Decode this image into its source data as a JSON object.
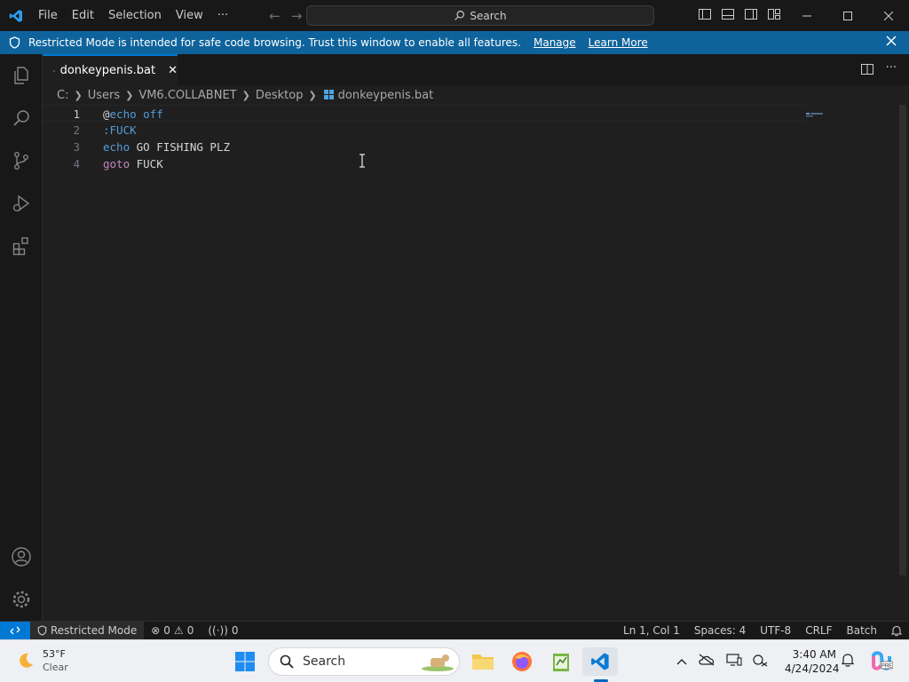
{
  "menu": [
    "File",
    "Edit",
    "Selection",
    "View",
    "···"
  ],
  "command_center": {
    "label": "Search"
  },
  "banner": {
    "message": "Restricted Mode is intended for safe code browsing. Trust this window to enable all features.",
    "manage": "Manage",
    "learn_more": "Learn More"
  },
  "tab": {
    "title": "donkeypenis.bat"
  },
  "breadcrumb": [
    "C:",
    "Users",
    "VM6.COLLABNET",
    "Desktop",
    "donkeypenis.bat"
  ],
  "editor": {
    "lines": [
      {
        "n": "1",
        "parts": [
          {
            "t": "@",
            "c": "txt"
          },
          {
            "t": "echo off",
            "c": "kw-blue"
          }
        ]
      },
      {
        "n": "2",
        "parts": [
          {
            "t": ":FUCK",
            "c": "kw-blue"
          }
        ]
      },
      {
        "n": "3",
        "parts": [
          {
            "t": "echo",
            "c": "kw-blue"
          },
          {
            "t": " GO FISHING PLZ",
            "c": "txt"
          }
        ]
      },
      {
        "n": "4",
        "parts": [
          {
            "t": "goto",
            "c": "kw-purple"
          },
          {
            "t": " FUCK",
            "c": "txt"
          }
        ]
      }
    ]
  },
  "statusbar": {
    "restricted": "Restricted Mode",
    "errors": "0",
    "warnings": "0",
    "ports": "0",
    "position": "Ln 1, Col 1",
    "spaces": "Spaces: 4",
    "encoding": "UTF-8",
    "eol": "CRLF",
    "language": "Batch"
  },
  "taskbar": {
    "temp": "53°F",
    "condition": "Clear",
    "search": "Search",
    "time": "3:40 AM",
    "date": "4/24/2024"
  },
  "colors": {
    "accent": "#0078d4",
    "banner": "#0e639c",
    "keyword": "#569cd6",
    "control": "#c586c0"
  }
}
